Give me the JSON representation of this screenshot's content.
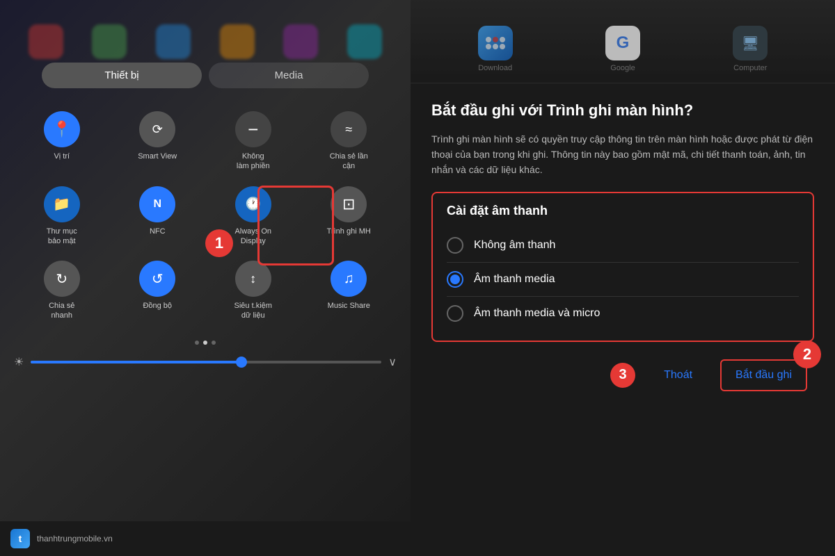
{
  "left_panel": {
    "tab_device": "Thiết bị",
    "tab_media": "Media",
    "quick_items": [
      {
        "id": "vi-tri",
        "label": "Vị trí",
        "icon": "📍",
        "color": "blue"
      },
      {
        "id": "smart-view",
        "label": "Smart View",
        "icon": "⟳",
        "color": "gray"
      },
      {
        "id": "khong-lam-phien",
        "label": "Không\nlàm phiền",
        "icon": "−",
        "color": "dark"
      },
      {
        "id": "chia-se-lan-can",
        "label": "Chia sẻ lần\ncận",
        "icon": "≈",
        "color": "dark"
      },
      {
        "id": "thu-muc-bao-mat",
        "label": "Thư mục\nbảo mật",
        "icon": "📁",
        "color": "blue2"
      },
      {
        "id": "nfc",
        "label": "NFC",
        "icon": "N",
        "color": "blue"
      },
      {
        "id": "always-on-display",
        "label": "Always On\nDisplay",
        "icon": "🕐",
        "color": "blue2"
      },
      {
        "id": "trinh-ghi-mh",
        "label": "Trình ghi MH",
        "icon": "⊡",
        "color": "dark",
        "highlighted": true
      },
      {
        "id": "chia-se-nhanh",
        "label": "Chia sẻ\nnhanh",
        "icon": "↻",
        "color": "gray"
      },
      {
        "id": "dong-bo",
        "label": "Đồng bộ",
        "icon": "↺",
        "color": "blue"
      },
      {
        "id": "sieu-tiem-kiem",
        "label": "Siêu t.kiệm\ndữ liệu",
        "icon": "↕",
        "color": "gray"
      },
      {
        "id": "music-share",
        "label": "Music Share",
        "icon": "♫",
        "color": "blue"
      }
    ],
    "step1_badge": "1",
    "dots": [
      "inactive",
      "active",
      "inactive"
    ],
    "brand_name": "thanhtrungmobile.vn"
  },
  "right_panel": {
    "top_apps": [
      {
        "label": "Download"
      },
      {
        "label": "Google"
      },
      {
        "label": "Computer"
      }
    ],
    "dialog_title": "Bắt đầu ghi với Trình ghi màn hình?",
    "dialog_desc": "Trình ghi màn hình sẽ có quyền truy cập thông tin trên màn hình hoặc được phát từ điện thoại của bạn trong khi ghi. Thông tin này bao gồm mật mã, chi tiết thanh toán, ảnh, tin nhắn và các dữ liệu khác.",
    "sound_settings_title": "Cài đặt âm thanh",
    "radio_options": [
      {
        "id": "no-sound",
        "label": "Không âm thanh",
        "selected": false
      },
      {
        "id": "media-sound",
        "label": "Âm thanh media",
        "selected": true
      },
      {
        "id": "media-mic",
        "label": "Âm thanh media và micro",
        "selected": false
      }
    ],
    "step2_badge": "2",
    "step3_badge": "3",
    "btn_cancel": "Thoát",
    "btn_start": "Bắt đầu ghi"
  }
}
